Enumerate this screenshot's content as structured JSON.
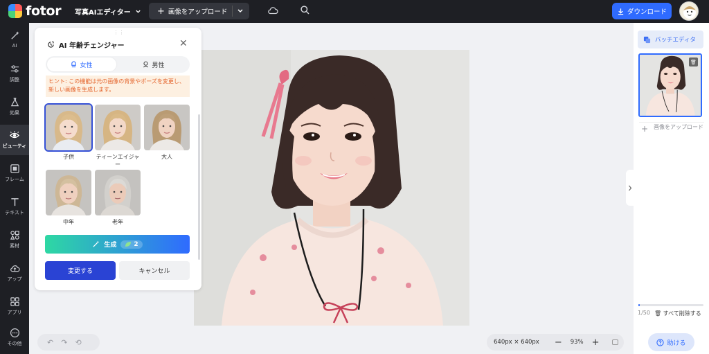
{
  "app": {
    "name": "fotor"
  },
  "topbar": {
    "editor_menu": "写真AIエディター",
    "upload_label": "画像をアップロード",
    "download_label": "ダウンロード"
  },
  "leftnav": {
    "items": [
      {
        "label": "AI",
        "icon": "magic-wand-icon"
      },
      {
        "label": "調整",
        "icon": "sliders-icon"
      },
      {
        "label": "効果",
        "icon": "flask-icon"
      },
      {
        "label": "ビューティ",
        "icon": "eye-icon",
        "active": true
      },
      {
        "label": "フレーム",
        "icon": "frame-icon"
      },
      {
        "label": "テキスト",
        "icon": "text-icon"
      },
      {
        "label": "素材",
        "icon": "elements-icon"
      },
      {
        "label": "アップ",
        "icon": "cloud-upload-icon"
      },
      {
        "label": "アプリ",
        "icon": "apps-icon"
      },
      {
        "label": "その他",
        "icon": "more-icon"
      }
    ]
  },
  "panel": {
    "title": "AI 年齢チェンジャー",
    "gender": {
      "female": "女性",
      "male": "男性",
      "selected": "女性"
    },
    "hint": "ヒント: この機能は元の画像の背景やポーズを変更し、新しい画像を生成します。",
    "ages": [
      {
        "label": "子供",
        "selected": true
      },
      {
        "label": "ティーンエイジャー",
        "selected": false
      },
      {
        "label": "大人",
        "selected": false
      },
      {
        "label": "中年",
        "selected": false
      },
      {
        "label": "老年",
        "selected": false
      }
    ],
    "generate_label": "生成",
    "credits": "2",
    "apply_label": "変更する",
    "cancel_label": "キャンセル"
  },
  "canvas": {
    "dimensions": "640px × 640px",
    "zoom": "93%"
  },
  "rightpanel": {
    "batch_label": "バッチエディタ",
    "upload_label": "画像をアップロード",
    "count": "1/50",
    "delete_all": "すべて削除する",
    "progress": 0.02,
    "help_label": "助ける"
  },
  "colors": {
    "accent": "#2f6bff",
    "dark_bg": "#1e1f24",
    "hint_text": "#e4632b",
    "hint_bg": "#fdf0e1",
    "apply_btn": "#2a43d4"
  }
}
